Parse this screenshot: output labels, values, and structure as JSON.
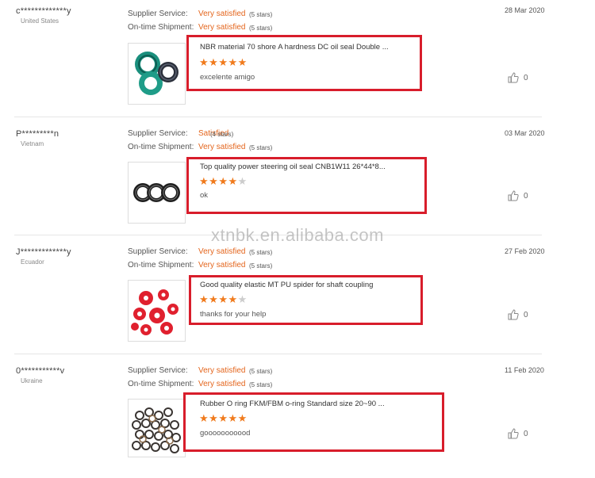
{
  "labels": {
    "supplier_service": "Supplier Service:",
    "on_time_shipment": "On-time Shipment:"
  },
  "reviews": [
    {
      "buyer": "c*************y",
      "country": "United States",
      "date": "28 Mar 2020",
      "supplier_service": {
        "value": "Very satisfied",
        "stars": "(5 stars)"
      },
      "on_time_shipment": {
        "value": "Very satisfied",
        "stars": "(5 stars)"
      },
      "product_title": "NBR material 70 shore A hardness DC oil seal Double ...",
      "rating": 5,
      "comment": "excelente amigo",
      "likes": "0",
      "thumbnail_icon": "green-oil-seals"
    },
    {
      "buyer": "P*********n",
      "country": "Vietnam",
      "date": "03 Mar 2020",
      "supplier_service": {
        "value": "Satisfied",
        "stars": "(4 stars)"
      },
      "on_time_shipment": {
        "value": "Very satisfied",
        "stars": "(5 stars)"
      },
      "product_title": "Top quality power steering oil seal CNB1W11 26*44*8...",
      "rating": 4,
      "comment": "ok",
      "likes": "0",
      "thumbnail_icon": "black-oil-seals"
    },
    {
      "buyer": "J*************y",
      "country": "Ecuador",
      "date": "27 Feb 2020",
      "supplier_service": {
        "value": "Very satisfied",
        "stars": "(5 stars)"
      },
      "on_time_shipment": {
        "value": "Very satisfied",
        "stars": "(5 stars)"
      },
      "product_title": "Good quality elastic MT PU spider for shaft coupling",
      "rating": 4,
      "comment": "thanks for your help",
      "likes": "0",
      "thumbnail_icon": "red-pu-spiders"
    },
    {
      "buyer": "0***********v",
      "country": "Ukraine",
      "date": "11 Feb 2020",
      "supplier_service": {
        "value": "Very satisfied",
        "stars": "(5 stars)"
      },
      "on_time_shipment": {
        "value": "Very satisfied",
        "stars": "(5 stars)"
      },
      "product_title": "Rubber O ring FKM/FBM o-ring Standard size 20~90 ...",
      "rating": 5,
      "comment": "gooooooooood",
      "likes": "0",
      "thumbnail_icon": "o-ring-pile"
    }
  ],
  "watermark": "xtnbk.en.alibaba.com",
  "colors": {
    "highlight": "#d81d2b",
    "star": "#f07a1c",
    "satisfaction": "#e4651c"
  }
}
